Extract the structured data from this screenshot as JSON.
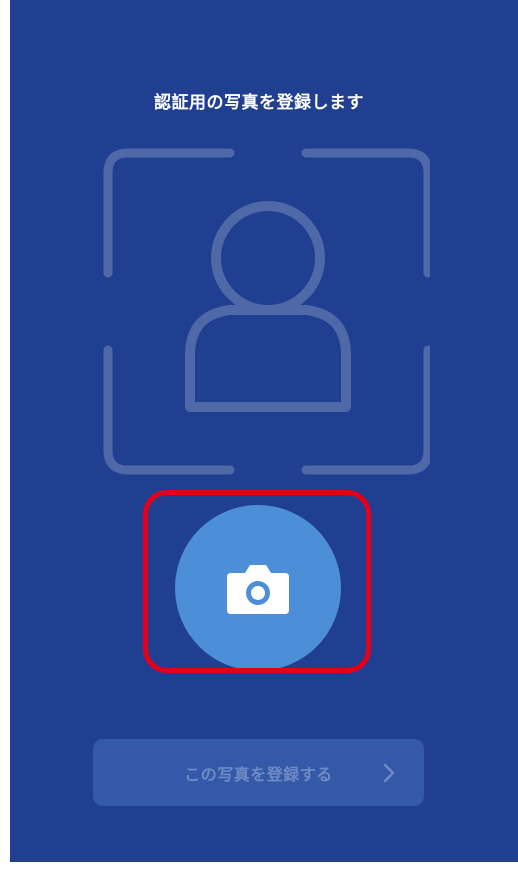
{
  "header": {
    "title": "認証用の写真を登録します"
  },
  "face_frame": {
    "icon": "person-silhouette-icon"
  },
  "camera_button": {
    "icon": "camera-icon",
    "highlighted": true
  },
  "register_button": {
    "label": "この写真を登録する",
    "icon": "chevron-right-icon",
    "enabled": false
  },
  "colors": {
    "background": "#213f91",
    "frame_stroke": "#4f68a8",
    "camera_button": "#4d8ed8",
    "highlight": "#e4001b",
    "disabled_button": "#3459a9",
    "disabled_text": "#6f8ac5"
  }
}
